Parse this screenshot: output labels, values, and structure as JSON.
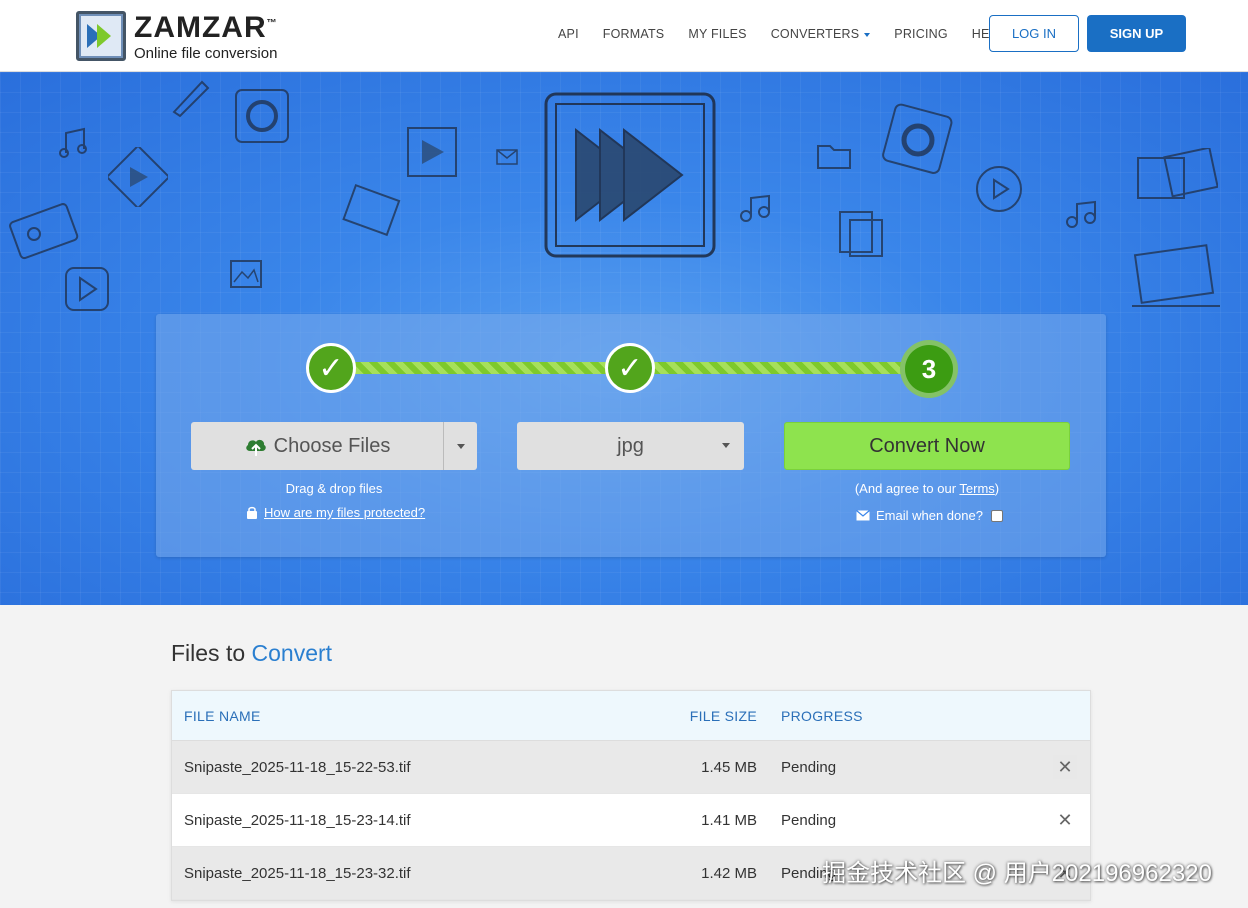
{
  "header": {
    "logo_name": "ZAMZAR",
    "logo_tm": "™",
    "logo_tagline": "Online file conversion",
    "nav": [
      "API",
      "FORMATS",
      "MY FILES",
      "CONVERTERS",
      "PRICING",
      "HELP"
    ],
    "login": "LOG IN",
    "signup": "SIGN UP"
  },
  "steps": {
    "step1": "✓",
    "step2": "✓",
    "step3": "3"
  },
  "converter": {
    "choose_files": "Choose Files",
    "format": "jpg",
    "convert_now": "Convert Now",
    "drag_drop": "Drag & drop files",
    "protected_link": "How are my files protected?",
    "agree_prefix": "(And agree to our ",
    "agree_terms": "Terms",
    "agree_suffix": ")",
    "email_label": "Email when done?"
  },
  "files": {
    "title_prefix": "Files to ",
    "title_highlight": "Convert",
    "columns": [
      "FILE NAME",
      "FILE SIZE",
      "PROGRESS"
    ],
    "rows": [
      {
        "name": "Snipaste_2025-11-18_15-22-53.tif",
        "size": "1.45 MB",
        "progress": "Pending"
      },
      {
        "name": "Snipaste_2025-11-18_15-23-14.tif",
        "size": "1.41 MB",
        "progress": "Pending"
      },
      {
        "name": "Snipaste_2025-11-18_15-23-32.tif",
        "size": "1.42 MB",
        "progress": "Pending"
      }
    ]
  },
  "watermark": "掘金技术社区 @ 用户202196962320",
  "colors": {
    "brand_blue": "#1a6fc4",
    "convert_green": "#8ee34e",
    "step_green": "#52a51c"
  }
}
